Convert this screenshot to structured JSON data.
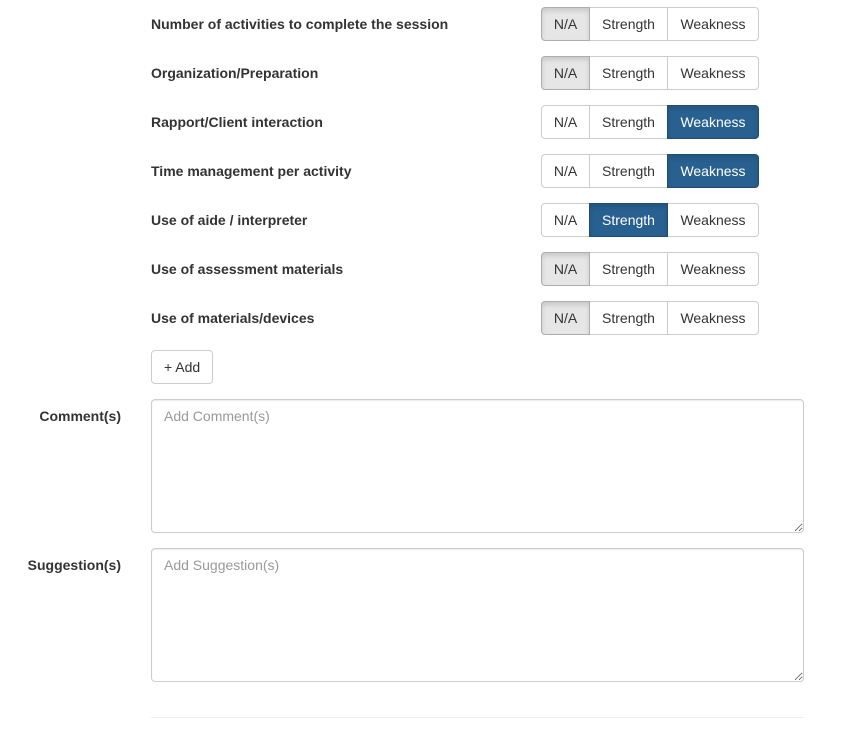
{
  "options": {
    "na": "N/A",
    "strength": "Strength",
    "weakness": "Weakness"
  },
  "ratings": [
    {
      "label": "Number of activities to complete the session",
      "selected": "na"
    },
    {
      "label": "Organization/Preparation",
      "selected": "na"
    },
    {
      "label": "Rapport/Client interaction",
      "selected": "weakness"
    },
    {
      "label": "Time management per activity",
      "selected": "weakness"
    },
    {
      "label": "Use of aide / interpreter",
      "selected": "strength"
    },
    {
      "label": "Use of assessment materials",
      "selected": "na"
    },
    {
      "label": "Use of materials/devices",
      "selected": "na"
    }
  ],
  "add_button": "+ Add",
  "comments": {
    "label": "Comment(s)",
    "placeholder": "Add Comment(s)",
    "value": ""
  },
  "suggestions": {
    "label": "Suggestion(s)",
    "placeholder": "Add Suggestion(s)",
    "value": ""
  },
  "colors": {
    "active_blue": "#286090",
    "active_gray": "#e6e6e6",
    "border": "#cccccc"
  }
}
